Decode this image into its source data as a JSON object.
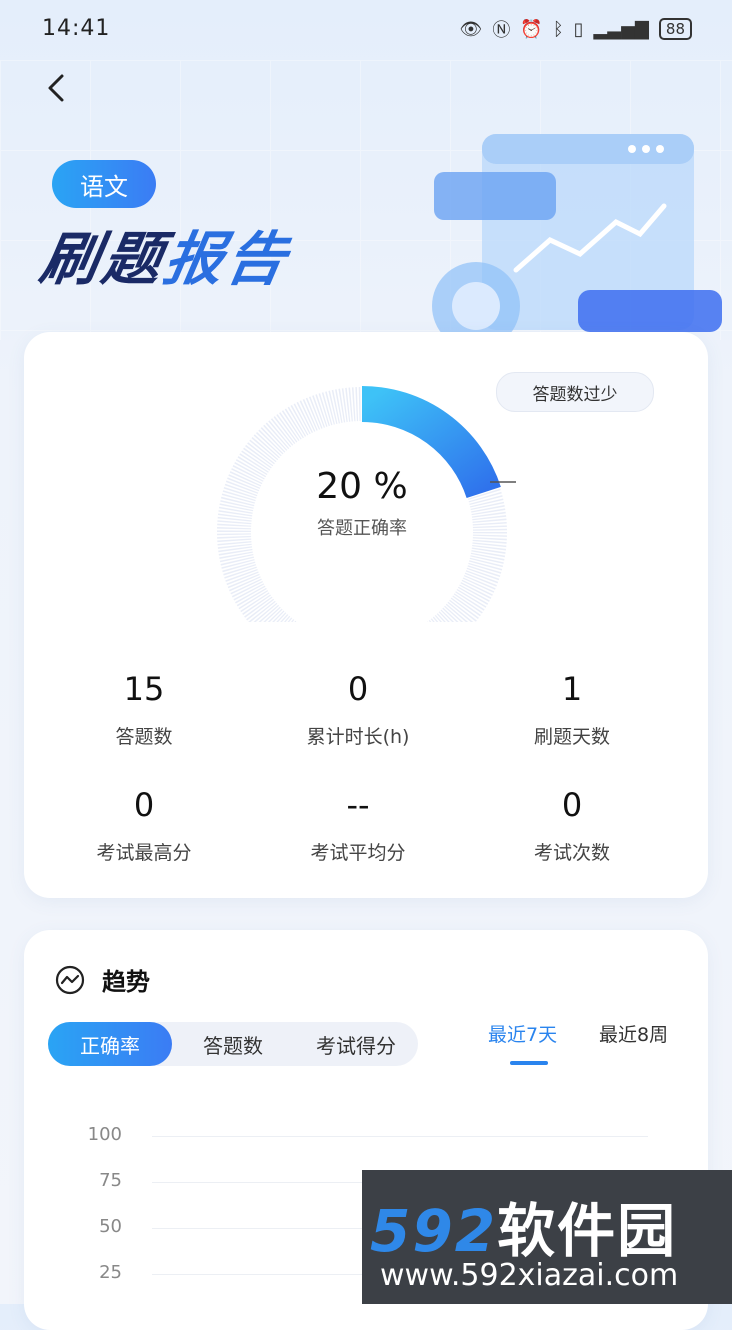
{
  "status_bar": {
    "time": "14:41",
    "battery": "88"
  },
  "header": {
    "subject": "语文",
    "title_part1": "刷题",
    "title_part2": "报告"
  },
  "accuracy": {
    "percent": "20 %",
    "label": "答题正确率",
    "tip": "答题数过少",
    "value_fraction": 0.2
  },
  "stats": [
    {
      "value": "15",
      "label": "答题数"
    },
    {
      "value": "0",
      "label": "累计时长(h)"
    },
    {
      "value": "1",
      "label": "刷题天数"
    },
    {
      "value": "0",
      "label": "考试最高分"
    },
    {
      "value": "--",
      "label": "考试平均分"
    },
    {
      "value": "0",
      "label": "考试次数"
    }
  ],
  "trend": {
    "title": "趋势",
    "segments": [
      "正确率",
      "答题数",
      "考试得分"
    ],
    "active_segment": "正确率",
    "ranges": [
      "最近7天",
      "最近8周"
    ],
    "active_range": "最近7天",
    "y_ticks": [
      "100",
      "75",
      "50",
      "25"
    ]
  },
  "watermark": {
    "brand": "592",
    "brand_cn": "软件园",
    "url": "www.592xiazai.com"
  },
  "colors": {
    "accent": "#2a84ee",
    "title": "#1a2a66"
  }
}
